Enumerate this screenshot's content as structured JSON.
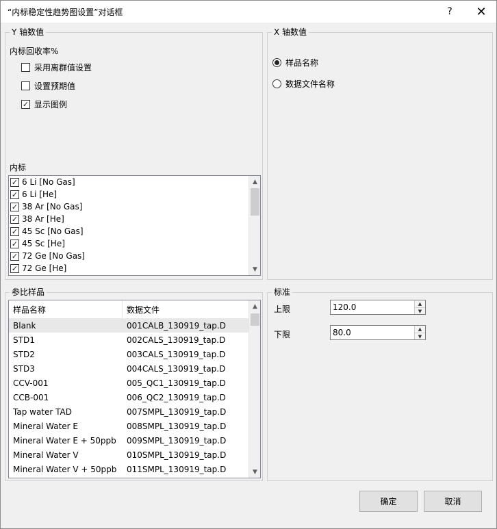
{
  "window": {
    "title": "“内标稳定性趋势图设置”对话框",
    "help_icon": "?",
    "close_icon": "✕"
  },
  "y_axis": {
    "legend": "Y 轴数值",
    "recovery_label": "内标回收率%",
    "options": [
      {
        "label": "采用离群值设置",
        "checked": false
      },
      {
        "label": "设置预期值",
        "checked": false
      },
      {
        "label": "显示图例",
        "checked": true
      }
    ],
    "internal_std_label": "内标",
    "internal_std_items": [
      {
        "label": "6 Li [No Gas]",
        "checked": true
      },
      {
        "label": "6 Li [He]",
        "checked": true
      },
      {
        "label": "38 Ar [No Gas]",
        "checked": true
      },
      {
        "label": "38 Ar [He]",
        "checked": true
      },
      {
        "label": "45 Sc [No Gas]",
        "checked": true
      },
      {
        "label": "45 Sc [He]",
        "checked": true
      },
      {
        "label": "72 Ge [No Gas]",
        "checked": true
      },
      {
        "label": "72 Ge [He]",
        "checked": true
      }
    ]
  },
  "x_axis": {
    "legend": "X 轴数值",
    "options": [
      {
        "label": "样品名称",
        "selected": true
      },
      {
        "label": "数据文件名称",
        "selected": false
      }
    ]
  },
  "ref_samples": {
    "legend": "参比样品",
    "columns": [
      "样品名称",
      "数据文件"
    ],
    "rows": [
      {
        "name": "Blank",
        "file": "001CALB_130919_tap.D",
        "selected": true
      },
      {
        "name": "STD1",
        "file": "002CALS_130919_tap.D",
        "selected": false
      },
      {
        "name": "STD2",
        "file": "003CALS_130919_tap.D",
        "selected": false
      },
      {
        "name": "STD3",
        "file": "004CALS_130919_tap.D",
        "selected": false
      },
      {
        "name": "CCV-001",
        "file": "005_QC1_130919_tap.D",
        "selected": false
      },
      {
        "name": "CCB-001",
        "file": "006_QC2_130919_tap.D",
        "selected": false
      },
      {
        "name": "Tap water TAD",
        "file": "007SMPL_130919_tap.D",
        "selected": false
      },
      {
        "name": "Mineral Water E",
        "file": "008SMPL_130919_tap.D",
        "selected": false
      },
      {
        "name": "Mineral Water E + 50ppb",
        "file": "009SMPL_130919_tap.D",
        "selected": false
      },
      {
        "name": "Mineral Water V",
        "file": "010SMPL_130919_tap.D",
        "selected": false
      },
      {
        "name": "Mineral Water V + 50ppb",
        "file": "011SMPL_130919_tap.D",
        "selected": false
      }
    ]
  },
  "standard": {
    "legend": "标准",
    "upper_label": "上限",
    "upper_value": "120.0",
    "lower_label": "下限",
    "lower_value": "80.0"
  },
  "buttons": {
    "ok": "确定",
    "cancel": "取消"
  },
  "glyphs": {
    "check": "✓",
    "up": "▲",
    "down": "▼"
  }
}
